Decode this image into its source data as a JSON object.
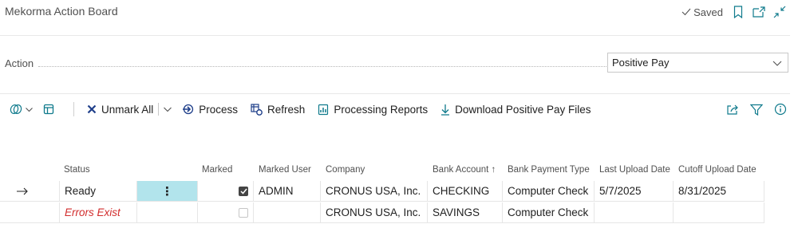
{
  "header": {
    "title": "Mekorma Action Board",
    "saved_label": "Saved"
  },
  "action": {
    "label": "Action",
    "selected": "Positive Pay"
  },
  "toolbar": {
    "unmark_all": "Unmark All",
    "process": "Process",
    "refresh": "Refresh",
    "processing_reports": "Processing Reports",
    "download_positive_pay_files": "Download Positive Pay Files"
  },
  "table": {
    "columns": {
      "status": "Status",
      "marked": "Marked",
      "marked_user": "Marked User",
      "company": "Company",
      "bank_account": "Bank Account",
      "bank_account_sort": "↑",
      "bank_payment_type": "Bank Payment Type",
      "last_upload_date": "Last Upload Date",
      "cutoff_upload_date": "Cutoff Upload Date"
    },
    "rows": [
      {
        "status": "Ready",
        "ellipsis": "⋮",
        "marked": true,
        "marked_user": "ADMIN",
        "company": "CRONUS USA, Inc.",
        "bank_account": "CHECKING",
        "bank_payment_type": "Computer Check",
        "last_upload_date": "5/7/2025",
        "cutoff_upload_date": "8/31/2025"
      },
      {
        "status": "Errors Exist",
        "marked": false,
        "marked_user": "",
        "company": "CRONUS USA, Inc.",
        "bank_account": "SAVINGS",
        "bank_payment_type": "Computer Check",
        "last_upload_date": "",
        "cutoff_upload_date": ""
      }
    ]
  },
  "colors": {
    "accent": "#0f7a8c",
    "selected_cell": "#b2e4ec",
    "error_text": "#d22d2d",
    "dark_red_icon": "#1f3f8a"
  }
}
